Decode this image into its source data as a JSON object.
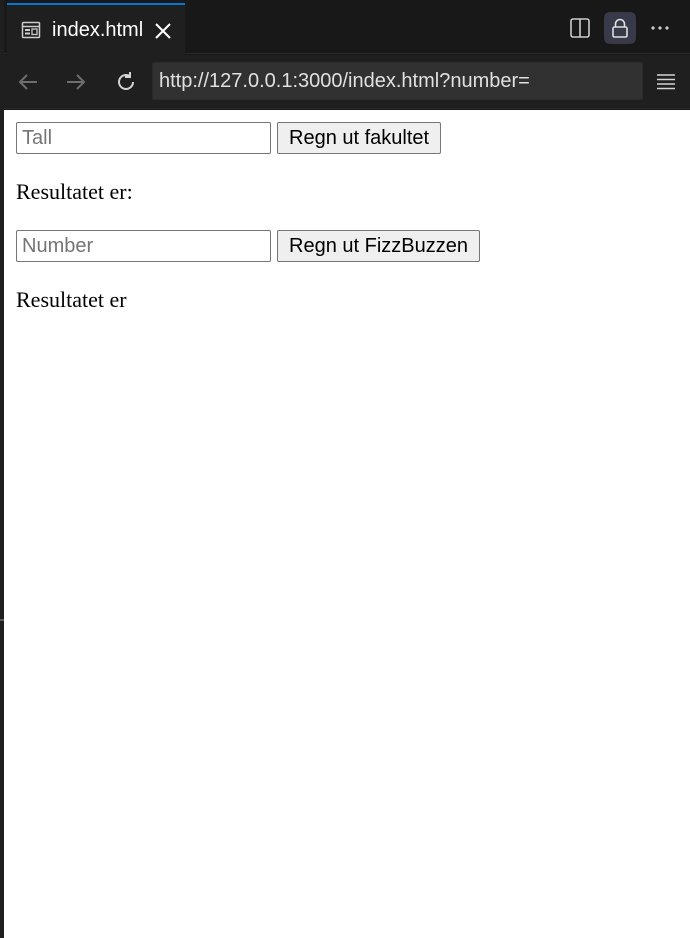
{
  "tab": {
    "title": "index.html",
    "icon": "preview-icon"
  },
  "toolbar": {
    "actions": [
      {
        "name": "split-editor-icon"
      },
      {
        "name": "lock-icon",
        "active": true
      },
      {
        "name": "more-actions-icon"
      }
    ]
  },
  "navigation": {
    "url": "http://127.0.0.1:3000/index.html?number="
  },
  "page": {
    "factorial": {
      "placeholder": "Tall",
      "value": "",
      "button_label": "Regn ut fakultet",
      "result_label": "Resultatet er:"
    },
    "fizzbuzz": {
      "placeholder": "Number",
      "value": "",
      "button_label": "Regn ut FizzBuzzen",
      "result_label": "Resultatet er"
    }
  },
  "colors": {
    "accent": "#0078d4",
    "chrome_bg": "#1f1f1f",
    "page_bg": "#ffffff"
  }
}
